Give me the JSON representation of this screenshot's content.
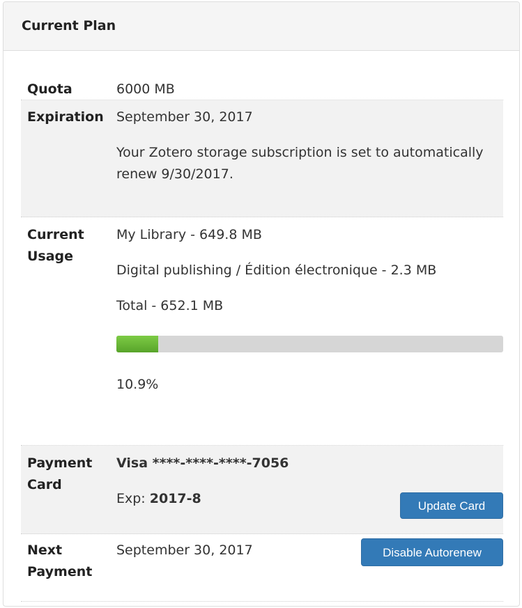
{
  "panel": {
    "title": "Current Plan"
  },
  "quota": {
    "label": "Quota",
    "value": "6000 MB"
  },
  "expiration": {
    "label": "Expiration",
    "date": "September 30, 2017",
    "note": "Your Zotero storage subscription is set to automatically renew 9/30/2017."
  },
  "usage": {
    "label": "Current Usage",
    "items": [
      "My Library - 649.8 MB",
      "Digital publishing / Édition électronique - 2.3 MB"
    ],
    "total": "Total - 652.1 MB",
    "percent_text": "10.9%",
    "fraction": 0.109
  },
  "payment_card": {
    "label": "Payment Card",
    "card_number": "Visa ****-****-****-7056",
    "exp_label": "Exp: ",
    "exp_value": "2017-8",
    "update_button": "Update Card"
  },
  "next_payment": {
    "label": "Next Payment",
    "date": "September 30, 2017",
    "disable_button": "Disable Autorenew"
  },
  "colors": {
    "button": "#337ab7",
    "progress_fill": "#6ab637",
    "progress_track": "#d6d6d6"
  }
}
